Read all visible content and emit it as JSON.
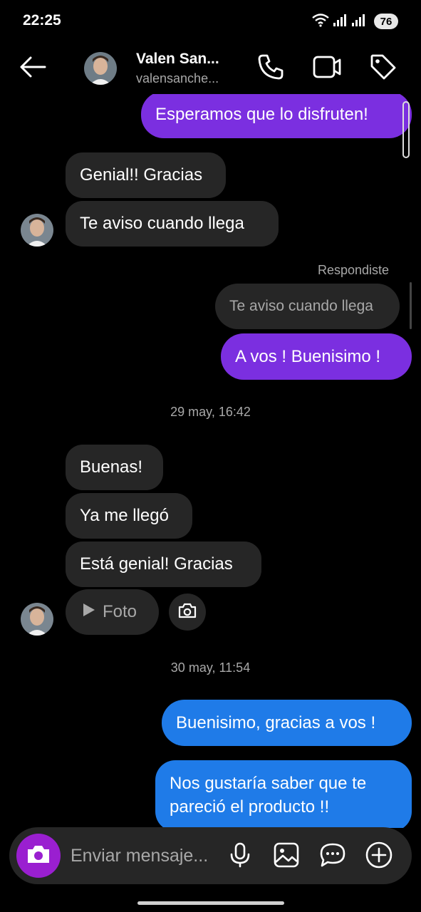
{
  "status_bar": {
    "time": "22:25",
    "battery": "76",
    "icons": [
      "wifi-icon",
      "signal-icon",
      "signal-icon-2"
    ]
  },
  "header": {
    "name": "Valen San...",
    "username": "valensanche...",
    "icons": [
      "back-arrow-icon",
      "phone-icon",
      "video-icon",
      "tag-icon"
    ]
  },
  "thread": {
    "messages": [
      {
        "direction": "outgoing",
        "text": "Esperamos que lo disfruten!",
        "color": "#7b2fe0"
      },
      {
        "direction": "incoming",
        "text": "Genial!! Gracias"
      },
      {
        "direction": "incoming",
        "text": "Te aviso cuando llega"
      },
      {
        "direction": "outgoing",
        "reply_label": "Respondiste",
        "quoted": "Te aviso cuando llega",
        "text": "A vos ! Buenisimo !",
        "color": "#7b2fe0"
      },
      {
        "timestamp": "29 may, 16:42"
      },
      {
        "direction": "incoming",
        "text": "Buenas!"
      },
      {
        "direction": "incoming",
        "text": "Ya me llegó"
      },
      {
        "direction": "incoming",
        "text": "Está genial! Gracias"
      },
      {
        "direction": "incoming",
        "photo_label": "Foto"
      },
      {
        "timestamp": "30 may, 11:54"
      },
      {
        "direction": "outgoing",
        "text": "Buenisimo, gracias a vos !",
        "color": "#1f7be8"
      },
      {
        "direction": "outgoing",
        "text_line1": "Nos gustaría saber que te",
        "text_line2": "pareció el producto !!",
        "color": "#1f7be8"
      }
    ]
  },
  "composer": {
    "placeholder": "Enviar mensaje...",
    "icons": [
      "camera-icon",
      "microphone-icon",
      "gallery-icon",
      "sticker-icon",
      "plus-icon"
    ]
  },
  "colors": {
    "background": "#000000",
    "incoming_bubble": "#262626",
    "outgoing_purple": "#7b2fe0",
    "outgoing_blue": "#1f7be8",
    "camera_button": "#9a1fd0"
  }
}
